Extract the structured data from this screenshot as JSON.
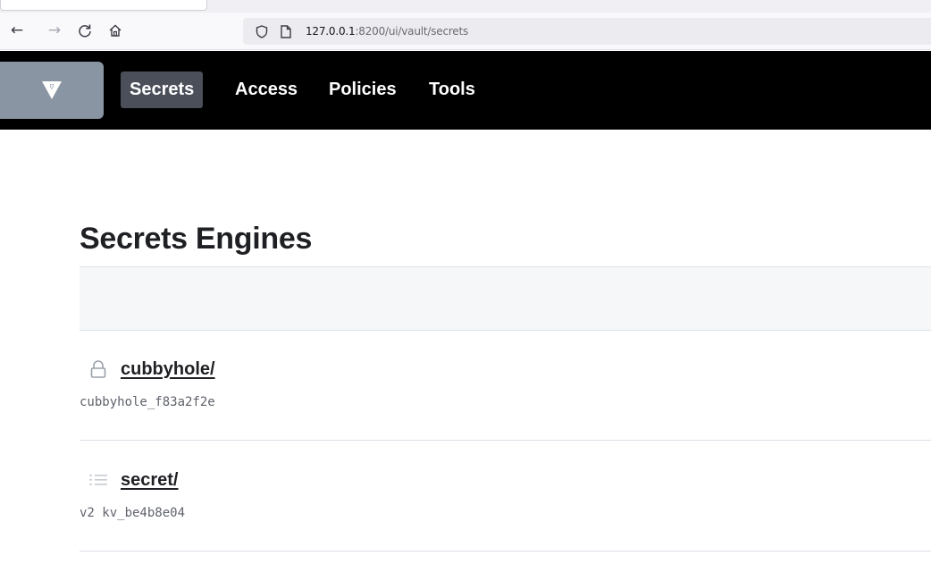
{
  "browser": {
    "nav_icons": {
      "back": "back-arrow-icon",
      "forward": "forward-arrow-icon",
      "reload": "reload-icon",
      "home": "home-icon",
      "shield": "shield-icon",
      "page": "page-icon"
    },
    "url_host": "127.0.0.1",
    "url_rest": ":8200/ui/vault/secrets"
  },
  "header": {
    "logo": "vault-logo",
    "nav": [
      {
        "label": "Secrets",
        "active": true
      },
      {
        "label": "Access",
        "active": false
      },
      {
        "label": "Policies",
        "active": false
      },
      {
        "label": "Tools",
        "active": false
      }
    ]
  },
  "main": {
    "title": "Secrets Engines",
    "engines": [
      {
        "name": "cubbyhole/",
        "description": "cubbyhole_f83a2f2e",
        "icon": "lock-icon"
      },
      {
        "name": "secret/",
        "description": "v2 kv_be4b8e04",
        "icon": "list-icon"
      }
    ]
  },
  "colors": {
    "header_bg": "#000000",
    "nav_active_bg": "#4a4f5a",
    "logo_bg": "#8a95a3",
    "title_text": "#1f2024",
    "divider": "#dce0e6"
  }
}
